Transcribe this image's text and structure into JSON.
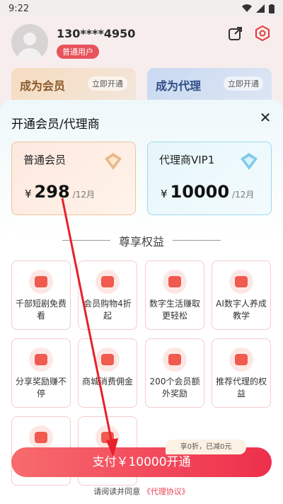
{
  "status_bar": {
    "time": "9:22"
  },
  "profile": {
    "phone": "130****4950",
    "badge": "普通用户"
  },
  "background_cards": [
    {
      "title": "成为会员",
      "button": "立即开通"
    },
    {
      "title": "成为代理",
      "button": "立即开通"
    }
  ],
  "sheet": {
    "title": "开通会员/代理商",
    "plans": [
      {
        "name": "普通会员",
        "currency": "¥",
        "amount": "298",
        "period": "/12月"
      },
      {
        "name": "代理商VIP1",
        "currency": "¥",
        "amount": "10000",
        "period": "/12月"
      }
    ],
    "benefits_title": "尊享权益",
    "benefits": [
      "千部短剧免费看",
      "会员购物4折起",
      "数字生活赚取更轻松",
      "AI数字人养成教学",
      "分享奖励赚不停",
      "商城消费佣金",
      "200个会员额外奖励",
      "推荐代理的权益",
      "",
      ""
    ],
    "discount_tag": "享0折，已减0元",
    "pay_button": "支付￥10000开通",
    "agreement_prefix": "请阅读并同意",
    "agreement_link": "《代理协议》"
  },
  "colors": {
    "accent": "#ee2f4c",
    "member_border": "#f0c49a",
    "agent_border": "#9fd8ef",
    "arrow": "#e8202a"
  }
}
